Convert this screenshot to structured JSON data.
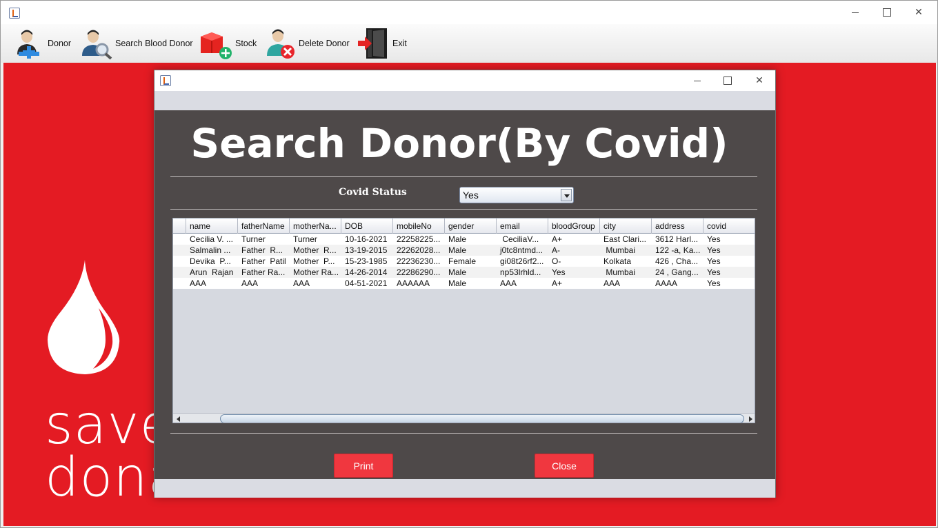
{
  "main_window": {
    "toolbar": [
      {
        "key": "donor",
        "label": "Donor",
        "icon": "add-user-icon"
      },
      {
        "key": "search",
        "label": "Search Blood Donor",
        "icon": "search-user-icon"
      },
      {
        "key": "stock",
        "label": "Stock",
        "icon": "stock-icon"
      },
      {
        "key": "delete",
        "label": "Delete Donor",
        "icon": "delete-user-icon"
      },
      {
        "key": "exit",
        "label": "Exit",
        "icon": "exit-door-icon"
      }
    ],
    "poster": {
      "line1": "save",
      "line2": "donate blood."
    }
  },
  "dialog": {
    "title": "Search Donor(By Covid)",
    "covid_label": "Covid Status",
    "covid_selected": "Yes",
    "buttons": {
      "print": "Print",
      "close": "Close"
    }
  },
  "table": {
    "columns": [
      "name",
      "fatherName",
      "motherNa...",
      "DOB",
      "mobileNo",
      "gender",
      "email",
      "bloodGroup",
      "city",
      "address",
      "covid"
    ],
    "rows": [
      [
        "Cecilia V. ...",
        "Turner",
        "Turner",
        "10-16-2021",
        "22258225...",
        "Male",
        " CeciliaV...",
        "A+",
        "East Clari...",
        "3612 Harl...",
        "Yes"
      ],
      [
        "Salmalin ...",
        "Father  R...",
        "Mother  R...",
        "13-19-2015",
        "22262028...",
        "Male",
        "j0tc8ntmd...",
        "A-",
        " Mumbai",
        "122 -a, Ka...",
        "Yes"
      ],
      [
        "Devika  P...",
        "Father  Patil",
        "Mother  P...",
        "15-23-1985",
        "22236230...",
        "Female",
        "gi08t26rf2...",
        "O-",
        "Kolkata",
        "426 , Cha...",
        "Yes"
      ],
      [
        "Arun  Rajan",
        "Father Ra...",
        "Mother Ra...",
        "14-26-2014",
        "22286290...",
        "Male",
        "np53lrhld...",
        "Yes",
        " Mumbai",
        "24 , Gang...",
        "Yes"
      ],
      [
        "AAA",
        "AAA",
        "AAA",
        "04-51-2021",
        "AAAAAA",
        "Male",
        "AAA",
        "A+",
        "AAA",
        "AAAA",
        "Yes"
      ]
    ]
  },
  "colors": {
    "poster_red": "#e41b23",
    "dialog_bg": "#4e4949",
    "button_red": "#f0373f"
  }
}
